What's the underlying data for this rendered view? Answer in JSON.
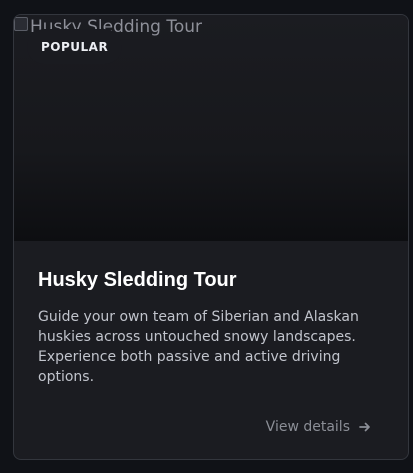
{
  "card": {
    "image_alt": "Husky Sledding Tour",
    "badge": "POPULAR",
    "title": "Husky Sledding Tour",
    "description": "Guide your own team of Siberian and Alaskan huskies across untouched snowy landscapes. Experience both passive and active driving options.",
    "cta": {
      "label": "View details",
      "icon": "arrow-right-icon"
    }
  }
}
